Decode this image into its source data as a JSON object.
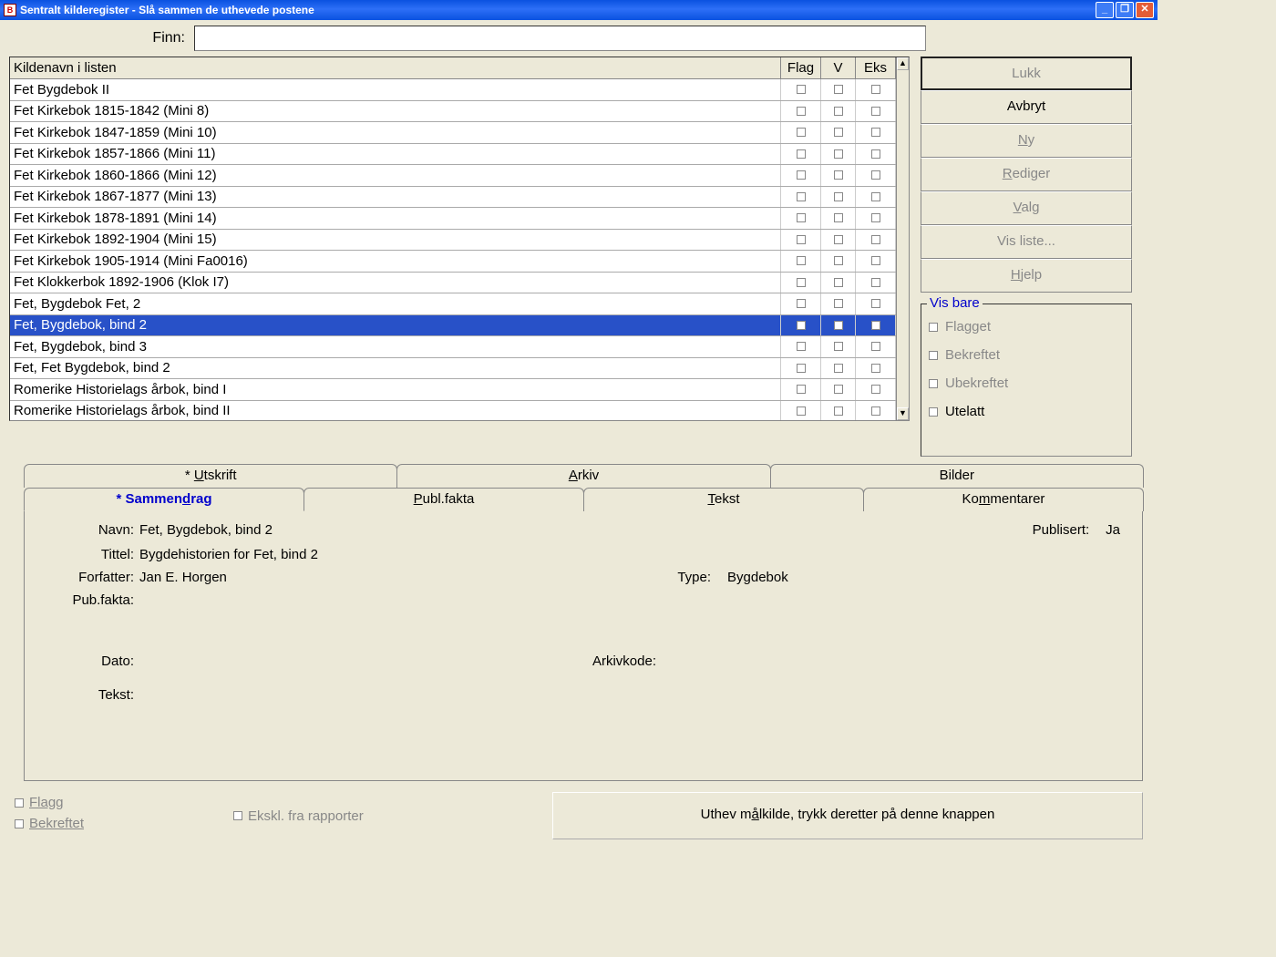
{
  "titlebar": {
    "app": "Sentralt kilderegister",
    "subtitle": "Slå sammen de uthevede postene"
  },
  "finn": {
    "label": "Finn:",
    "value": ""
  },
  "grid": {
    "headers": {
      "name": "Kildenavn i listen",
      "flag": "Flag",
      "v": "V",
      "eks": "Eks"
    },
    "rows": [
      {
        "name": "Fet Bygdebok II",
        "selected": false
      },
      {
        "name": "Fet Kirkebok 1815-1842 (Mini 8)",
        "selected": false
      },
      {
        "name": "Fet Kirkebok 1847-1859 (Mini 10)",
        "selected": false
      },
      {
        "name": "Fet Kirkebok 1857-1866 (Mini 11)",
        "selected": false
      },
      {
        "name": "Fet Kirkebok 1860-1866 (Mini 12)",
        "selected": false
      },
      {
        "name": "Fet Kirkebok 1867-1877 (Mini 13)",
        "selected": false
      },
      {
        "name": "Fet Kirkebok 1878-1891 (Mini 14)",
        "selected": false
      },
      {
        "name": "Fet Kirkebok 1892-1904 (Mini 15)",
        "selected": false
      },
      {
        "name": "Fet Kirkebok 1905-1914 (Mini Fa0016)",
        "selected": false
      },
      {
        "name": "Fet Klokkerbok 1892-1906 (Klok I7)",
        "selected": false
      },
      {
        "name": "Fet, Bygdebok Fet, 2",
        "selected": false
      },
      {
        "name": "Fet, Bygdebok, bind 2",
        "selected": true
      },
      {
        "name": "Fet, Bygdebok, bind 3",
        "selected": false
      },
      {
        "name": "Fet, Fet Bygdebok, bind 2",
        "selected": false
      },
      {
        "name": "Romerike Historielags årbok, bind I",
        "selected": false
      },
      {
        "name": "Romerike Historielags årbok, bind II",
        "selected": false
      }
    ]
  },
  "sidebar": {
    "btns": {
      "lukk": "Lukk",
      "avbryt": "Avbryt",
      "ny": "Ny",
      "rediger": "Rediger",
      "valg": "Valg",
      "visliste": "Vis liste...",
      "hjelp": "Hjelp"
    }
  },
  "visbare": {
    "title": "Vis bare",
    "flagget": "Flagget",
    "bekreftet": "Bekreftet",
    "ubekreftet": "Ubekreftet",
    "utelatt": "Utelatt"
  },
  "tabs": {
    "row1": {
      "utskrift": "* Utskrift",
      "arkiv": "Arkiv",
      "bilder": "Bilder"
    },
    "row2": {
      "sammendrag": "* Sammendrag",
      "publfakta": "Publ.fakta",
      "tekst": "Tekst",
      "kommentarer": "Kommentarer"
    }
  },
  "detail": {
    "navn_label": "Navn:",
    "navn": "Fet, Bygdebok, bind 2",
    "publisert_label": "Publisert:",
    "publisert": "Ja",
    "tittel_label": "Tittel:",
    "tittel": "Bygdehistorien for Fet, bind 2",
    "forfatter_label": "Forfatter:",
    "forfatter": "Jan E. Horgen",
    "type_label": "Type:",
    "type": "Bygdebok",
    "pubfakta_label": "Pub.fakta:",
    "pubfakta": "",
    "dato_label": "Dato:",
    "dato": "",
    "arkivkode_label": "Arkivkode:",
    "arkivkode": "",
    "tekst_label": "Tekst:",
    "tekst": ""
  },
  "bottom": {
    "flagg": "Flagg",
    "bekreftet": "Bekreftet",
    "ekskl": "Ekskl. fra rapporter",
    "merge": "Uthev målkilde, trykk deretter på denne knappen"
  }
}
